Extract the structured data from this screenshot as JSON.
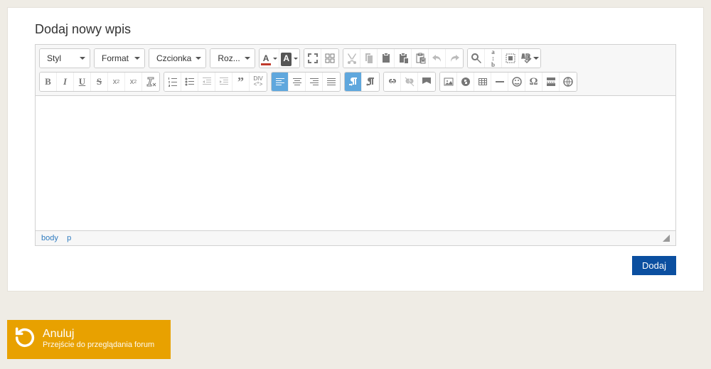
{
  "heading": "Dodaj nowy wpis",
  "dropdowns": {
    "style": "Styl",
    "format": "Format",
    "font": "Czcionka",
    "size": "Roz..."
  },
  "textcolor_letter": "A",
  "bgcolor_letter": "A",
  "path": {
    "body": "body",
    "p": "p"
  },
  "submit_label": "Dodaj",
  "cancel": {
    "title": "Anuluj",
    "subtitle": "Przejście do przeglądania forum"
  }
}
